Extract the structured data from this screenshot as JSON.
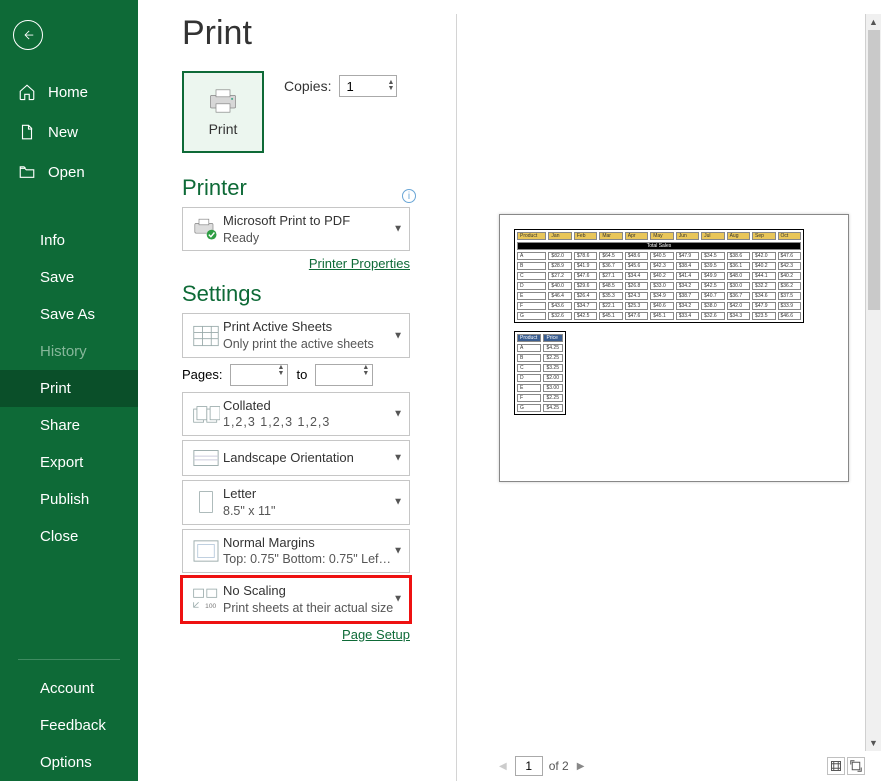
{
  "sidebar": {
    "iconItems": [
      {
        "key": "home",
        "label": "Home"
      },
      {
        "key": "new",
        "label": "New"
      },
      {
        "key": "open",
        "label": "Open"
      }
    ],
    "items": [
      {
        "key": "info",
        "label": "Info"
      },
      {
        "key": "save",
        "label": "Save"
      },
      {
        "key": "saveas",
        "label": "Save As"
      },
      {
        "key": "history",
        "label": "History",
        "disabled": true
      },
      {
        "key": "print",
        "label": "Print",
        "selected": true
      },
      {
        "key": "share",
        "label": "Share"
      },
      {
        "key": "export",
        "label": "Export"
      },
      {
        "key": "publish",
        "label": "Publish"
      },
      {
        "key": "close",
        "label": "Close"
      }
    ],
    "bottomItems": [
      {
        "key": "account",
        "label": "Account"
      },
      {
        "key": "feedback",
        "label": "Feedback"
      },
      {
        "key": "options",
        "label": "Options"
      }
    ]
  },
  "page": {
    "title": "Print"
  },
  "print_tile": {
    "label": "Print"
  },
  "copies": {
    "label": "Copies:",
    "value": "1"
  },
  "printer": {
    "heading": "Printer",
    "name": "Microsoft Print to PDF",
    "status": "Ready",
    "properties_link": "Printer Properties"
  },
  "settings": {
    "heading": "Settings",
    "active": {
      "title": "Print Active Sheets",
      "sub": "Only print the active sheets"
    },
    "pages": {
      "label": "Pages:",
      "to": "to"
    },
    "collated": {
      "title": "Collated",
      "seq": "1,2,3    1,2,3    1,2,3"
    },
    "orientation": {
      "title": "Landscape Orientation"
    },
    "paper": {
      "title": "Letter",
      "sub": "8.5\" x 11\""
    },
    "margins": {
      "title": "Normal Margins",
      "sub": "Top: 0.75\" Bottom: 0.75\" Lef…"
    },
    "scaling": {
      "title": "No Scaling",
      "sub": "Print sheets at their actual size"
    },
    "page_setup_link": "Page Setup"
  },
  "preview": {
    "current_page": "1",
    "of_label": "of 2"
  }
}
